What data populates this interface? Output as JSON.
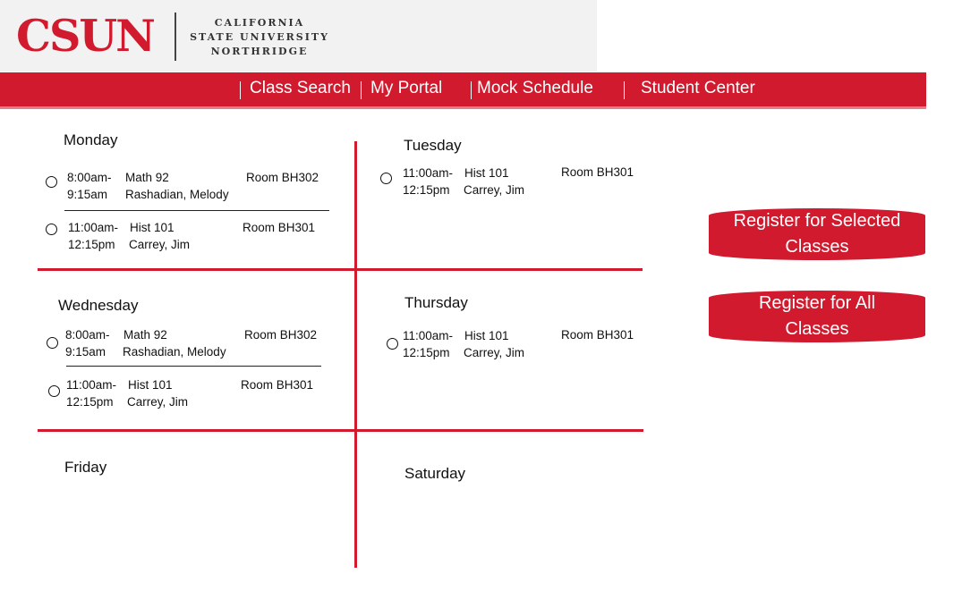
{
  "logo": {
    "word": "CSUN",
    "line1": "CALIFORNIA",
    "line2": "STATE UNIVERSITY",
    "line3": "NORTHRIDGE",
    "brand_color": "#d11a2e"
  },
  "nav": {
    "items": [
      {
        "label": "Class Search"
      },
      {
        "label": "My Portal"
      },
      {
        "label": "Mock Schedule"
      },
      {
        "label": "Student Center"
      }
    ]
  },
  "days": {
    "monday": {
      "heading": "Monday",
      "classes": [
        {
          "start": "8:00am-",
          "end": "9:15am",
          "course": "Math 92",
          "instructor": "Rashadian, Melody",
          "room": "Room BH302"
        },
        {
          "start": "11:00am-",
          "end": "12:15pm",
          "course": "Hist 101",
          "instructor": "Carrey, Jim",
          "room": "Room BH301"
        }
      ]
    },
    "tuesday": {
      "heading": "Tuesday",
      "classes": [
        {
          "start": "11:00am-",
          "end": "12:15pm",
          "course": "Hist 101",
          "instructor": "Carrey, Jim",
          "room": "Room BH301"
        }
      ]
    },
    "wednesday": {
      "heading": "Wednesday",
      "classes": [
        {
          "start": "8:00am-",
          "end": "9:15am",
          "course": "Math 92",
          "instructor": "Rashadian, Melody",
          "room": "Room BH302"
        },
        {
          "start": "11:00am-",
          "end": "12:15pm",
          "course": "Hist 101",
          "instructor": "Carrey, Jim",
          "room": "Room BH301"
        }
      ]
    },
    "thursday": {
      "heading": "Thursday",
      "classes": [
        {
          "start": "11:00am-",
          "end": "12:15pm",
          "course": "Hist 101",
          "instructor": "Carrey, Jim",
          "room": "Room BH301"
        }
      ]
    },
    "friday": {
      "heading": "Friday",
      "classes": []
    },
    "saturday": {
      "heading": "Saturday",
      "classes": []
    }
  },
  "actions": {
    "register_selected_line1": "Register for Selected",
    "register_selected_line2": "Classes",
    "register_all_line1": "Register for All",
    "register_all_line2": "Classes"
  }
}
